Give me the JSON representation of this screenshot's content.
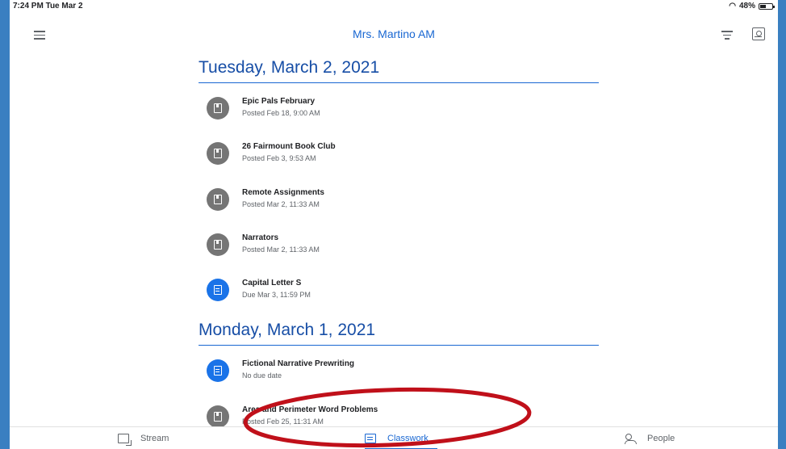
{
  "status_bar": {
    "time": "7:24 PM  Tue Mar 2",
    "battery": "48%",
    "battery_level": 0.48
  },
  "header": {
    "class_title": "Mrs. Martino AM"
  },
  "sections": [
    {
      "date": "Tuesday, March 2, 2021",
      "items": [
        {
          "title": "Epic Pals February",
          "subtitle": "Posted Feb 18, 9:00 AM",
          "icon": "material-icon"
        },
        {
          "title": " 26 Fairmount Book Club",
          "subtitle": "Posted Feb 3, 9:53 AM",
          "icon": "material-icon"
        },
        {
          "title": "Remote Assignments",
          "subtitle": "Posted Mar 2, 11:33 AM",
          "icon": "material-icon"
        },
        {
          "title": "Narrators",
          "subtitle": "Posted Mar 2, 11:33 AM",
          "icon": "material-icon"
        },
        {
          "title": "Capital Letter S",
          "subtitle": "Due Mar 3, 11:59 PM",
          "icon": "assignment-icon"
        }
      ]
    },
    {
      "date": "Monday, March 1, 2021",
      "items": [
        {
          "title": "Fictional Narrative Prewriting",
          "subtitle": "No due date",
          "icon": "assignment-icon"
        },
        {
          "title": "Area and Perimeter Word Problems",
          "subtitle": "Posted Feb 25, 11:31 AM",
          "icon": "material-icon"
        }
      ]
    }
  ],
  "bottom_nav": {
    "stream": "Stream",
    "classwork": "Classwork",
    "people": "People"
  },
  "colors": {
    "accent": "#1967d2",
    "material_gray": "#757575",
    "annotation_red": "#c0101a"
  }
}
